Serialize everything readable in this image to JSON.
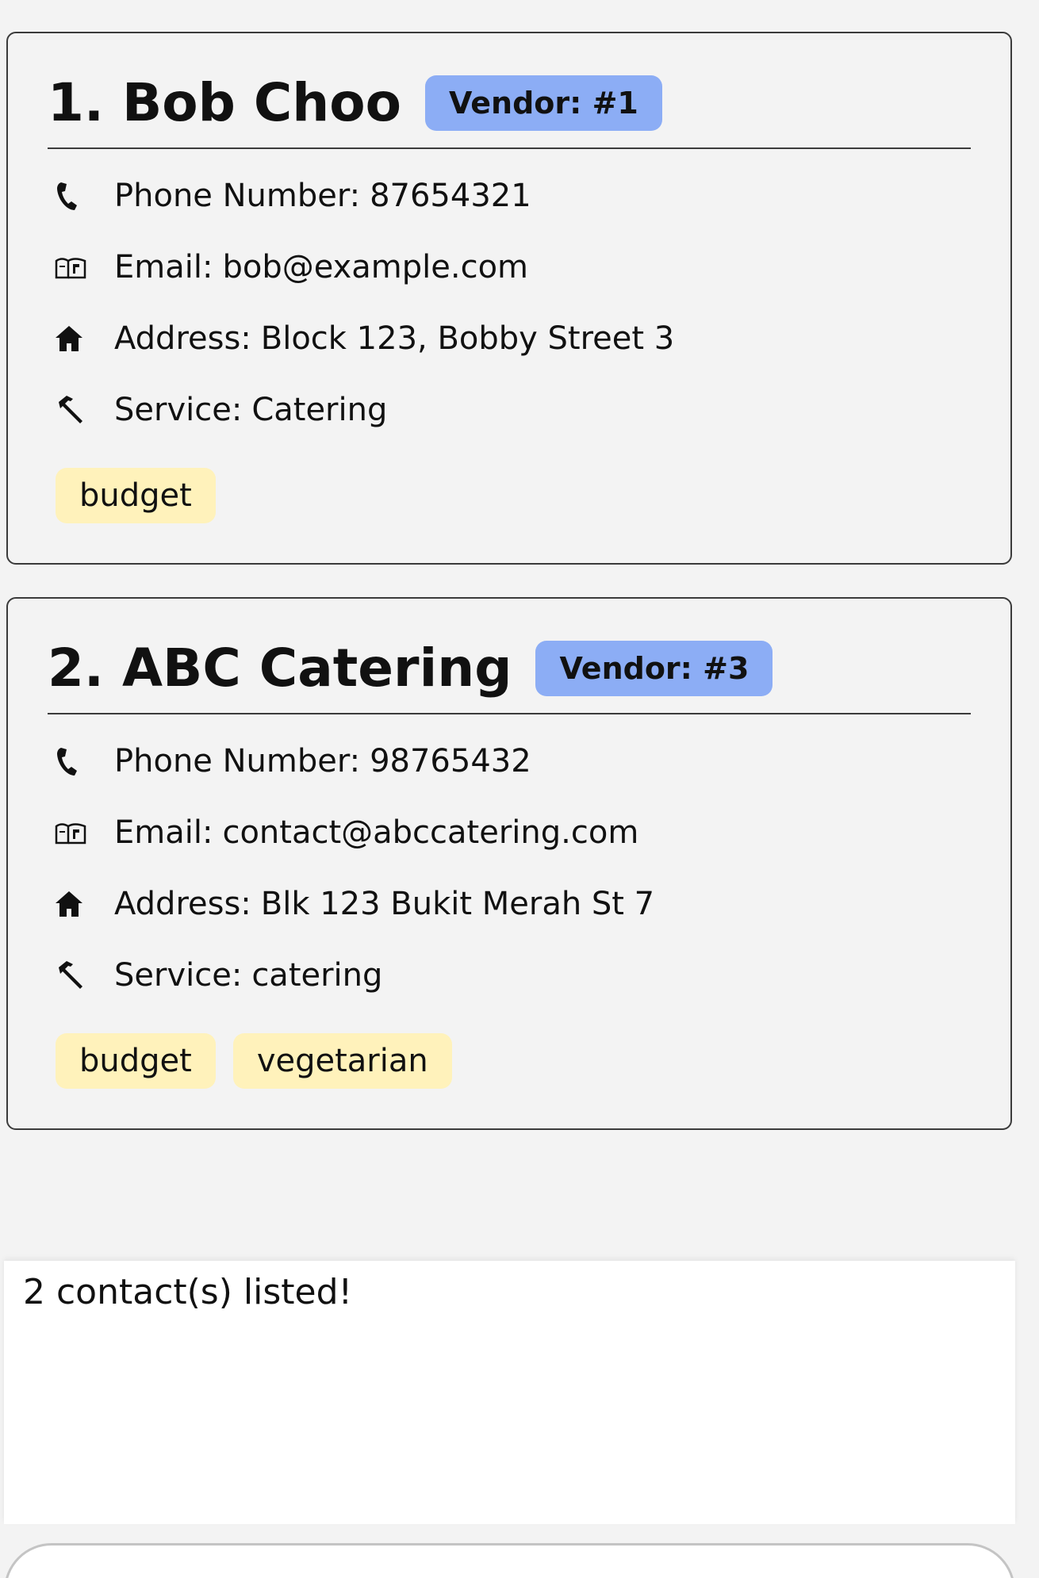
{
  "contacts": [
    {
      "name": "1. Bob Choo",
      "badge": "Vendor: #1",
      "phone_label": "Phone Number:",
      "phone": "87654321",
      "email_label": "Email:",
      "email": "bob@example.com",
      "address_label": "Address:",
      "address": "Block 123, Bobby Street 3",
      "service_label": "Service:",
      "service": "Catering",
      "tags": [
        "budget"
      ]
    },
    {
      "name": "2. ABC Catering",
      "badge": "Vendor: #3",
      "phone_label": "Phone Number:",
      "phone": "98765432",
      "email_label": "Email:",
      "email": "contact@abccatering.com",
      "address_label": "Address:",
      "address": "Blk 123 Bukit Merah St 7",
      "service_label": "Service:",
      "service": "catering",
      "tags": [
        "budget",
        "vegetarian"
      ]
    }
  ],
  "result_display": {
    "message": "2 contact(s) listed!"
  },
  "command_box": {
    "value": ""
  },
  "colors": {
    "background": "#f3f3f3",
    "vendor_badge": "#8cadf5",
    "tag": "#fff2bb",
    "card_border": "#3b3b3b"
  },
  "icons": {
    "phone": "phone-icon",
    "email": "mailbox-icon",
    "address": "house-icon",
    "service": "hammer-icon"
  }
}
